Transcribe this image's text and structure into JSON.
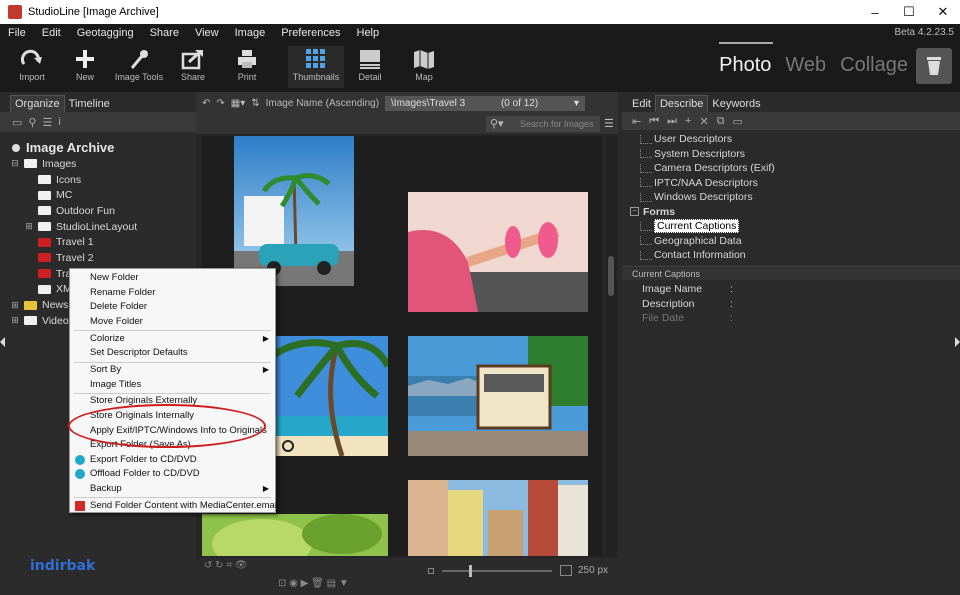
{
  "window": {
    "title": "StudioLine [Image Archive]",
    "version": "Beta 4.2.23.5",
    "controls": [
      "–",
      "☐",
      "✕"
    ]
  },
  "menu": [
    "File",
    "Edit",
    "Geotagging",
    "Share",
    "View",
    "Image",
    "Preferences",
    "Help"
  ],
  "toolbar": {
    "items": [
      {
        "label": "Import",
        "icon": "import-icon"
      },
      {
        "label": "New",
        "icon": "plus-icon"
      },
      {
        "label": "Image Tools",
        "icon": "dropper-icon"
      },
      {
        "label": "Share",
        "icon": "share-icon"
      },
      {
        "label": "Print",
        "icon": "printer-icon"
      },
      {
        "label": "Thumbnails",
        "icon": "thumbnails-icon"
      },
      {
        "label": "Detail",
        "icon": "detail-icon"
      },
      {
        "label": "Map",
        "icon": "map-icon"
      }
    ],
    "modes": [
      "Photo",
      "Web",
      "Collage"
    ]
  },
  "left": {
    "tabs": [
      "Organize",
      "Timeline"
    ],
    "root": "Image Archive",
    "tree": [
      {
        "label": "Images",
        "exp": "⊟",
        "color": "white",
        "indent": 0
      },
      {
        "label": "Icons",
        "exp": "",
        "color": "white",
        "indent": 1
      },
      {
        "label": "MC",
        "exp": "",
        "color": "white",
        "indent": 1
      },
      {
        "label": "Outdoor Fun",
        "exp": "",
        "color": "white",
        "indent": 1
      },
      {
        "label": "StudioLineLayout",
        "exp": "⊞",
        "color": "white",
        "indent": 1
      },
      {
        "label": "Travel 1",
        "exp": "",
        "color": "red",
        "indent": 1
      },
      {
        "label": "Travel 2",
        "exp": "",
        "color": "red",
        "indent": 1
      },
      {
        "label": "Travel 3",
        "exp": "",
        "color": "red",
        "indent": 1
      },
      {
        "label": "XMA",
        "exp": "",
        "color": "white",
        "indent": 1
      },
      {
        "label": "News",
        "exp": "⊞",
        "color": "yellow",
        "indent": 0
      },
      {
        "label": "Videos",
        "exp": "⊞",
        "color": "white",
        "indent": 0
      }
    ]
  },
  "center": {
    "sort": "Image Name (Ascending)",
    "path": "\\Images\\Travel 3",
    "count": "(0 of 12)",
    "search_placeholder": "Search for Images",
    "zoom": "250 px"
  },
  "context_menu": {
    "items": [
      {
        "label": "New Folder"
      },
      {
        "label": "Rename Folder"
      },
      {
        "label": "Delete Folder"
      },
      {
        "label": "Move Folder",
        "sep_after": true
      },
      {
        "label": "Colorize",
        "submenu": true
      },
      {
        "label": "Set Descriptor Defaults",
        "sep_after": true
      },
      {
        "label": "Sort By",
        "submenu": true
      },
      {
        "label": "Image Titles",
        "sep_after": true
      },
      {
        "label": "Store Originals Externally"
      },
      {
        "label": "Store Originals Internally"
      },
      {
        "label": "Apply Exif/IPTC/Windows Info to Originals"
      },
      {
        "label": "Export Folder (Save As)"
      },
      {
        "label": "Export Folder to CD/DVD",
        "icon": "disc"
      },
      {
        "label": "Offload Folder to CD/DVD",
        "icon": "disc"
      },
      {
        "label": "Backup",
        "submenu": true,
        "sep_after": true
      },
      {
        "label": "Send Folder Content with MediaCenter.email",
        "icon": "mc"
      }
    ]
  },
  "right": {
    "tabs": [
      "Edit",
      "Describe",
      "Keywords"
    ],
    "descriptors": [
      "User Descriptors",
      "System Descriptors",
      "Camera Descriptors (Exif)",
      "IPTC/NAA Descriptors",
      "Windows Descriptors"
    ],
    "forms_label": "Forms",
    "forms": [
      "Current Captions",
      "Geographical Data",
      "Contact Information"
    ],
    "captions_header": "Current Captions",
    "fields": [
      {
        "label": "Image Name",
        "value": ":"
      },
      {
        "label": "Description",
        "value": ":"
      },
      {
        "label": "File Date",
        "value": ":"
      }
    ]
  },
  "watermark": "indirbak"
}
